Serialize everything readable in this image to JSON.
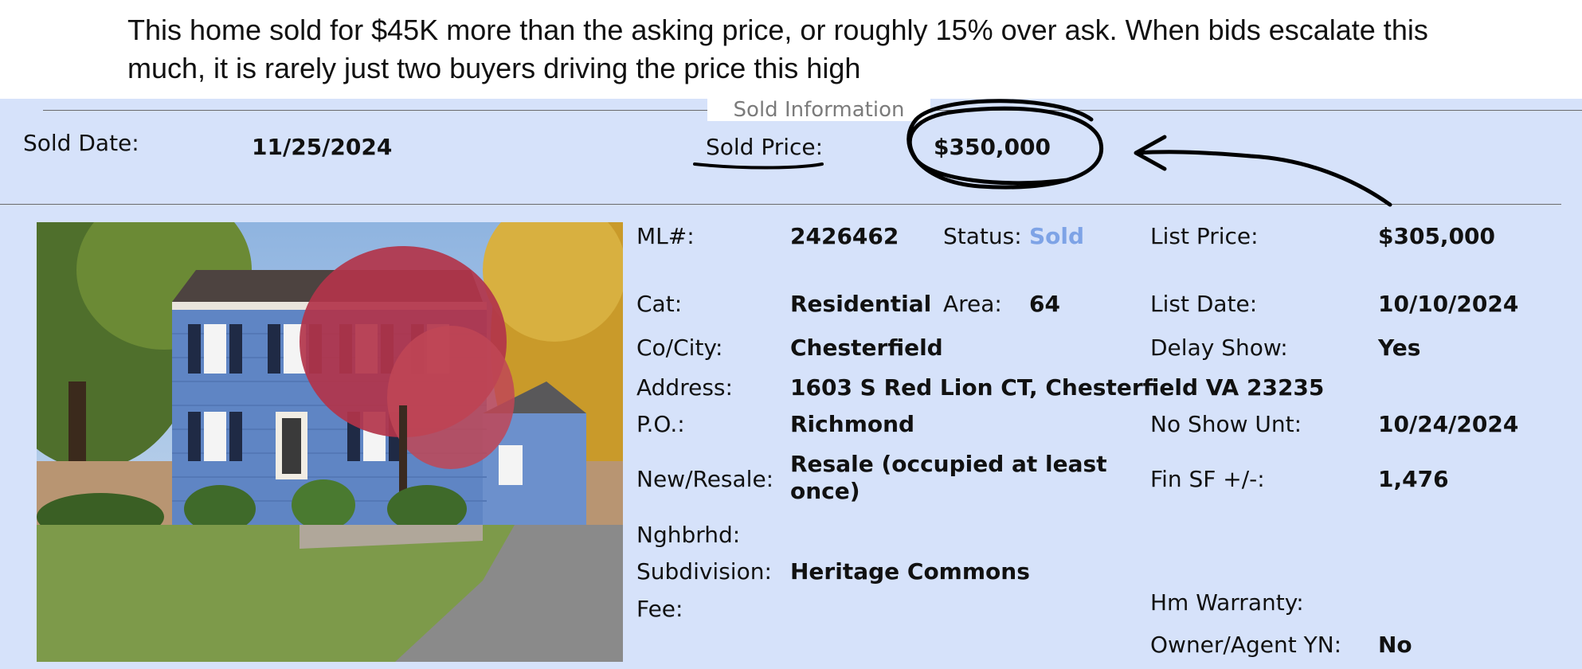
{
  "caption": "This home sold for $45K more than the asking price, or roughly 15% over ask. When bids escalate this much, it is rarely just two buyers driving the price this high",
  "sold_info": {
    "legend": "Sold Information",
    "sold_date_label": "Sold Date:",
    "sold_date": "11/25/2024",
    "sold_price_label": "Sold Price:",
    "sold_price": "$350,000"
  },
  "listing": {
    "ml_label": "ML#:",
    "ml": "2426462",
    "status_label": "Status:",
    "status": "Sold",
    "list_price_label": "List Price:",
    "list_price": "$305,000",
    "cat_label": "Cat:",
    "cat": "Residential",
    "area_label": "Area:",
    "area": "64",
    "list_date_label": "List Date:",
    "list_date": "10/10/2024",
    "city_label": "Co/City:",
    "city": "Chesterfield",
    "delay_show_label": "Delay Show:",
    "delay_show": "Yes",
    "address_label": "Address:",
    "address": "1603 S Red Lion CT, Chesterfield VA 23235",
    "po_label": "P.O.:",
    "po": "Richmond",
    "no_show_label": "No Show Unt:",
    "no_show": "10/24/2024",
    "new_resale_label": "New/Resale:",
    "new_resale": "Resale (occupied at least once)",
    "fin_sf_label": "Fin SF +/-:",
    "fin_sf": "1,476",
    "nghbrhd_label": "Nghbrhd:",
    "subdivision_label": "Subdivision:",
    "subdivision": "Heritage Commons",
    "fee_label": "Fee:",
    "hm_warranty_label": "Hm Warranty:",
    "owner_agent_label": "Owner/Agent YN:",
    "owner_agent": "No"
  },
  "colors": {
    "panel": "#d6e2fa",
    "status_sold": "#7ea3e6",
    "ink": "#000000"
  },
  "annotations": {
    "circle": "hand-drawn circle around sold price",
    "arrow": "hand-drawn arrow pointing to sold price",
    "underline": "hand-drawn underline under Sold Price label"
  }
}
